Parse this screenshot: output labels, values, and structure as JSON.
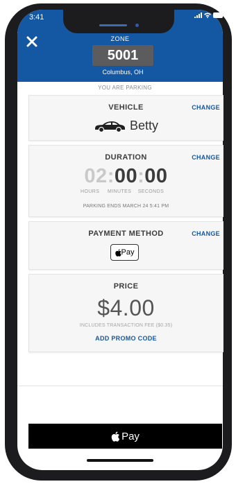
{
  "status_bar": {
    "time": "3:41"
  },
  "header": {
    "zone_label": "ZONE",
    "zone_number": "5001",
    "city": "Columbus, OH"
  },
  "parking_label": "YOU ARE PARKING",
  "vehicle": {
    "title": "VEHICLE",
    "change": "CHANGE",
    "name": "Betty"
  },
  "duration": {
    "title": "DURATION",
    "change": "CHANGE",
    "hours": "02",
    "minutes": "00",
    "seconds": "00",
    "sep": ":",
    "unit_hours": "HOURS",
    "unit_minutes": "MINUTES",
    "unit_seconds": "SECONDS",
    "ends": "PARKING ENDS MARCH 24 5:41 PM"
  },
  "payment": {
    "title": "PAYMENT METHOD",
    "change": "CHANGE",
    "badge_text": "Pay"
  },
  "price": {
    "title": "PRICE",
    "amount": "$4.00",
    "fee": "INCLUDES TRANSACTION FEE ($0.35)",
    "promo": "ADD PROMO CODE"
  },
  "pay_button": {
    "label": "Pay"
  },
  "colors": {
    "brand_blue": "#1457a3",
    "zone_box": "#5c5c5e"
  }
}
